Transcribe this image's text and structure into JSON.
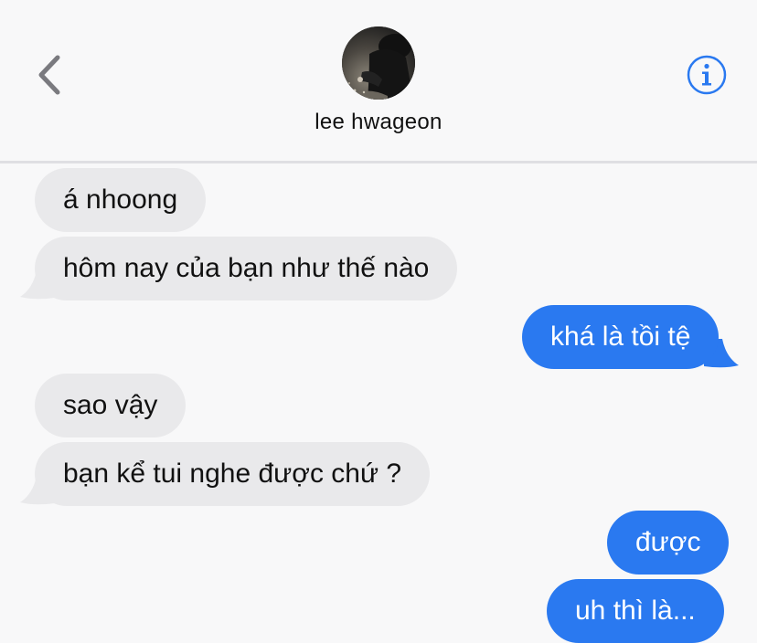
{
  "header": {
    "contact_name": "lee hwageon",
    "back_icon": "chevron-left-icon",
    "info_icon": "info-icon",
    "accent_color": "#2a79f0"
  },
  "messages": [
    {
      "direction": "incoming",
      "text": "á nhoong"
    },
    {
      "direction": "incoming",
      "text": "hôm nay của bạn như thế nào"
    },
    {
      "direction": "outgoing",
      "text": "khá là tồi tệ"
    },
    {
      "direction": "incoming",
      "text": "sao vậy"
    },
    {
      "direction": "incoming",
      "text": "bạn kể tui nghe được chứ ?"
    },
    {
      "direction": "outgoing",
      "text": "được"
    },
    {
      "direction": "outgoing",
      "text": "uh thì là..."
    }
  ],
  "colors": {
    "incoming_bubble": "#e9e9eb",
    "outgoing_bubble": "#2a79f0",
    "background": "#f8f8f9"
  }
}
